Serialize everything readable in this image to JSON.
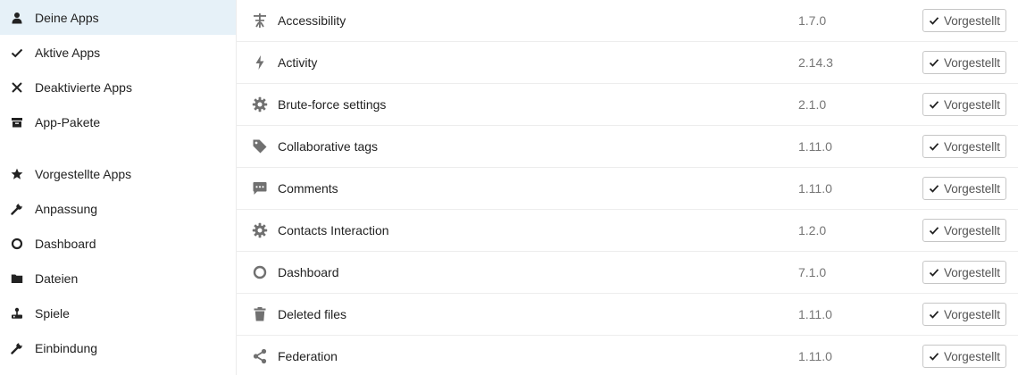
{
  "sidebar": {
    "items": [
      {
        "label": "Deine Apps",
        "icon": "user-icon"
      },
      {
        "label": "Aktive Apps",
        "icon": "checkmark-icon"
      },
      {
        "label": "Deaktivierte Apps",
        "icon": "close-icon"
      },
      {
        "label": "App-Pakete",
        "icon": "archive-icon"
      },
      {
        "label": "Vorgestellte Apps",
        "icon": "star-icon"
      },
      {
        "label": "Anpassung",
        "icon": "wrench-icon"
      },
      {
        "label": "Dashboard",
        "icon": "circle-icon"
      },
      {
        "label": "Dateien",
        "icon": "folder-icon"
      },
      {
        "label": "Spiele",
        "icon": "joystick-icon"
      },
      {
        "label": "Einbindung",
        "icon": "wrench-icon"
      }
    ],
    "active_index": 0
  },
  "apps": [
    {
      "name": "Accessibility",
      "version": "1.7.0",
      "badge": "Vorgestellt",
      "icon": "accessibility-icon"
    },
    {
      "name": "Activity",
      "version": "2.14.3",
      "badge": "Vorgestellt",
      "icon": "lightning-icon"
    },
    {
      "name": "Brute-force settings",
      "version": "2.1.0",
      "badge": "Vorgestellt",
      "icon": "gear-icon"
    },
    {
      "name": "Collaborative tags",
      "version": "1.11.0",
      "badge": "Vorgestellt",
      "icon": "tag-icon"
    },
    {
      "name": "Comments",
      "version": "1.11.0",
      "badge": "Vorgestellt",
      "icon": "comment-icon"
    },
    {
      "name": "Contacts Interaction",
      "version": "1.2.0",
      "badge": "Vorgestellt",
      "icon": "gear-icon"
    },
    {
      "name": "Dashboard",
      "version": "7.1.0",
      "badge": "Vorgestellt",
      "icon": "circle-icon"
    },
    {
      "name": "Deleted files",
      "version": "1.11.0",
      "badge": "Vorgestellt",
      "icon": "trash-icon"
    },
    {
      "name": "Federation",
      "version": "1.11.0",
      "badge": "Vorgestellt",
      "icon": "share-icon"
    }
  ],
  "colors": {
    "active_nav_bg": "#e6f1f8",
    "icon": "#222222",
    "app_icon": "#707070",
    "version_text": "#767676",
    "button_border": "#c6c6c6"
  }
}
